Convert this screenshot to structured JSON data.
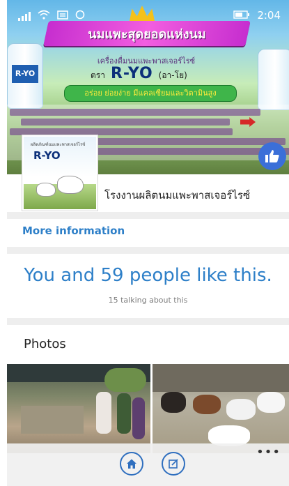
{
  "status_bar": {
    "time": "2:04"
  },
  "cover": {
    "banner": "นมแพะสุดยอดแห่งนม",
    "subtitle": "เครื่องดื่มนมแพะพาสเจอร์ไรซ์",
    "brand_prefix": "ตรา",
    "brand": "R-YO",
    "brand_reading": "(อา-โย)",
    "slogan": "อร่อย ย่อยง่าย มีแคลเซียมและวิตามินสูง",
    "bottle_label": "R-YO",
    "colors": {
      "banner": "#d33ad6",
      "brand": "#0b2f7a",
      "slogan_bg": "#3fb54a"
    }
  },
  "avatar": {
    "small_text": "ผลิตภัณฑ์นมแพะพาสเจอร์ไรซ์",
    "brand": "R-YO"
  },
  "page": {
    "name": "โรงงานผลิตนมแพะพาสเจอร์ไรซ์"
  },
  "links": {
    "more_information": "More information"
  },
  "likes": {
    "text": "You and 59 people like this.",
    "talking": "15 talking about this"
  },
  "photos": {
    "title": "Photos"
  },
  "icons": {
    "like": "thumbs-up-icon",
    "home": "home-icon",
    "compose": "compose-icon",
    "more": "more-icon"
  },
  "accent": "#2d7fc8"
}
